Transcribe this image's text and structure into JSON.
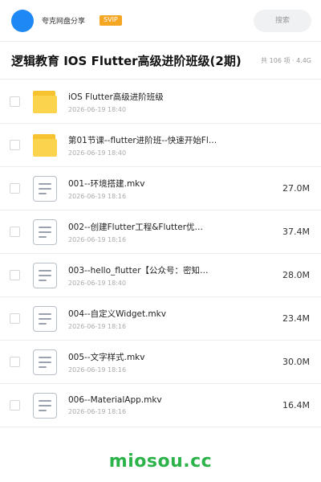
{
  "header": {
    "brand": "夸克网盘分享",
    "badge": "SVIP",
    "search_placeholder": "搜索"
  },
  "titlebar": {
    "title": "逻辑教育 IOS Flutter高级进阶班级(2期)",
    "meta": "共 106 项 · 4.4G"
  },
  "files": [
    {
      "type": "folder",
      "name": "iOS Flutter高级进阶班级",
      "date": "2026-06-19 18:40",
      "size": ""
    },
    {
      "type": "folder",
      "name": "第01节课--flutter进阶班--快速开始Fl…",
      "date": "2026-06-19 18:40",
      "size": ""
    },
    {
      "type": "file",
      "name": "001--环境搭建.mkv",
      "date": "2026-06-19 18:16",
      "size": "27.0M"
    },
    {
      "type": "file",
      "name": "002--创建Flutter工程&Flutter优…",
      "date": "2026-06-19 18:16",
      "size": "37.4M"
    },
    {
      "type": "file",
      "name": "003--hello_flutter【公众号：密知…",
      "date": "2026-06-19 18:40",
      "size": "28.0M"
    },
    {
      "type": "file",
      "name": "004--自定义Widget.mkv",
      "date": "2026-06-19 18:16",
      "size": "23.4M"
    },
    {
      "type": "file",
      "name": "005--文字样式.mkv",
      "date": "2026-06-19 18:16",
      "size": "30.0M"
    },
    {
      "type": "file",
      "name": "006--MaterialApp.mkv",
      "date": "2026-06-19 18:16",
      "size": "16.4M"
    }
  ],
  "watermark": "miosou.cc",
  "colors": {
    "avatar": "#1e88f5",
    "badge": "#f5a623",
    "folder": "#fcd34d",
    "watermark": "#2bb34a"
  }
}
